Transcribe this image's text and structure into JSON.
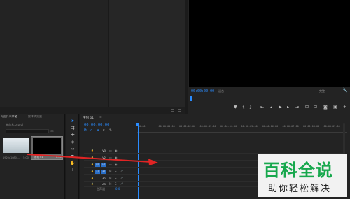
{
  "source": {
    "bottom_icons": [
      "bin-icon",
      "export-frame-icon"
    ]
  },
  "program": {
    "timecode": "00:00:00:00",
    "fit": "适合",
    "quality": "完整",
    "transport_icons": [
      "marker-icon",
      "in-point-icon",
      "out-point-icon",
      "go-to-in-icon",
      "step-back-icon",
      "play-icon",
      "step-forward-icon",
      "go-to-out-icon",
      "insert-icon",
      "overwrite-icon",
      "export-frame-icon",
      "compare-icon",
      "button-editor-icon"
    ]
  },
  "project": {
    "tabs": [
      "项目: 未命名",
      "媒体浏览器"
    ],
    "project_file": "未命名.prproj",
    "items": [
      {
        "name": "1920x1080 ...",
        "duration": "5:00"
      },
      {
        "name": "序列 01",
        "duration": "0:00"
      }
    ]
  },
  "tools": [
    "selection-tool-icon",
    "track-select-icon",
    "ripple-edit-icon",
    "razor-icon",
    "slip-icon",
    "pen-icon",
    "hand-icon",
    "type-icon"
  ],
  "timeline": {
    "tab_label": "序列 01",
    "close": "≡",
    "timecode": "00:00:00:00",
    "ruler_ticks": [
      "00:00",
      "00:00:01:00",
      "00:00:02:00",
      "00:00:03:00",
      "00:00:04:00",
      "00:00:05:00",
      "00:00:06:00",
      "00:00:07:00",
      "00:00:08:00",
      "00:00:09:00"
    ],
    "tracks": [
      {
        "id": "V3",
        "type": "video"
      },
      {
        "id": "V2",
        "type": "video"
      },
      {
        "id": "V1",
        "type": "video",
        "target": "V1"
      },
      {
        "id": "A1",
        "type": "audio",
        "target": "A1"
      },
      {
        "id": "A2",
        "type": "audio"
      },
      {
        "id": "A3",
        "type": "audio"
      }
    ],
    "master_label": "主声道",
    "master_value": "0.0"
  },
  "watermark": {
    "title": "百科全说",
    "subtitle": "助你轻松解决"
  },
  "colors": {
    "accent": "#2a8cff",
    "arrow": "#e02424",
    "watermark_green": "#17a84d"
  }
}
